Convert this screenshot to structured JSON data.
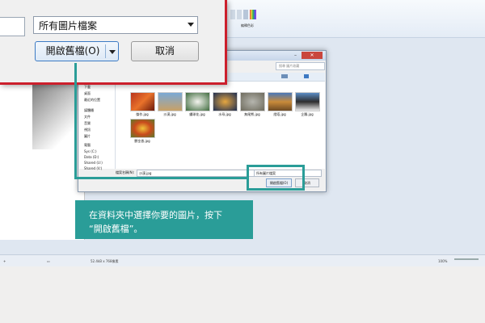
{
  "ribbon": {
    "edit_colors_label": "編輯色彩"
  },
  "status_bar": {
    "size": "52.4kB x 768像素",
    "zoom": "100%"
  },
  "small_dialog": {
    "search_placeholder": "搜尋 圖片收藏",
    "tree_items": [
      "下載",
      "桌面",
      "最近的位置",
      "媒體櫃",
      "文件",
      "音樂",
      "視訊",
      "圖片",
      "電腦",
      "Sys (C:)",
      "Data (D:)",
      "Shared (U:)",
      "Shared (V:)"
    ],
    "thumbnails": [
      "傑作.jpg",
      "沙漠.jpg",
      "繡球花.jpg",
      "水母.jpg",
      "無尾熊.jpg",
      "燈塔.jpg",
      "企鵝.jpg",
      "鬱金香.jpg"
    ],
    "filename_label": "檔案名稱(N):",
    "filename_value": "沙漠.jpg",
    "filetype_value": "所有圖片檔案",
    "open_label": "開啟舊檔(O)",
    "cancel_label": "取消"
  },
  "zoom_dialog": {
    "filetype_value": "所有圖片檔案",
    "open_label": "開啟舊檔(O)",
    "cancel_label": "取消"
  },
  "callout": {
    "line1": "在資料夾中選擇你要的圖片，按下",
    "line2": "“開啟舊檔”。"
  },
  "colors": {
    "accent": "#2a9d98",
    "zoom_border": "#cc1f2c"
  }
}
